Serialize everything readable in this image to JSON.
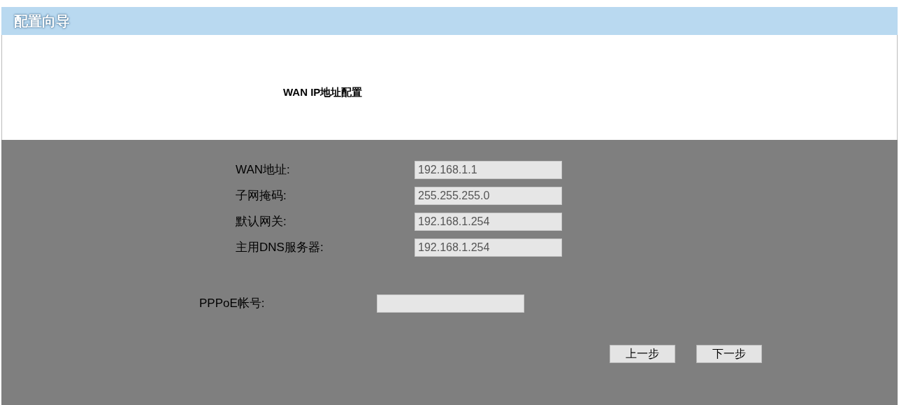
{
  "window": {
    "title": "配置向导"
  },
  "section": {
    "title": "WAN IP地址配置"
  },
  "static_fields": [
    {
      "label": "WAN地址:",
      "value": "192.168.1.1"
    },
    {
      "label": "子网掩码:",
      "value": "255.255.255.0"
    },
    {
      "label": "默认网关:",
      "value": "192.168.1.254"
    },
    {
      "label": "主用DNS服务器:",
      "value": "192.168.1.254"
    }
  ],
  "pppoe_fields": [
    {
      "label": "PPPoE帐号:"
    }
  ],
  "buttons": [
    {
      "label": "上一步"
    },
    {
      "label": "下一步"
    }
  ]
}
